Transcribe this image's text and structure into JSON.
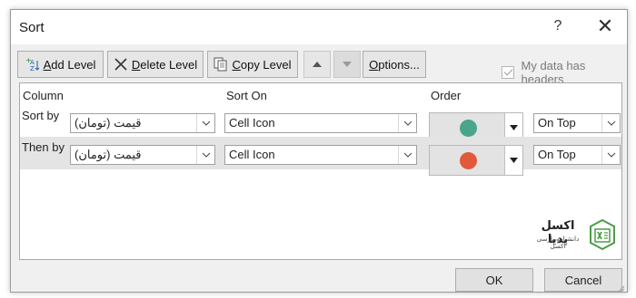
{
  "dialog": {
    "title": "Sort",
    "help_label": "?",
    "close_label": "✕"
  },
  "toolbar": {
    "add_level": {
      "hotkey": "A",
      "rest": "dd Level"
    },
    "delete_level": {
      "hotkey": "D",
      "rest": "elete Level"
    },
    "copy_level": {
      "hotkey": "C",
      "rest": "opy Level"
    },
    "options": {
      "hotkey": "O",
      "rest": "ptions..."
    }
  },
  "headers_check": {
    "label_pre": "My data has ",
    "hotkey": "h",
    "label_post": "eaders",
    "checked": true
  },
  "grid": {
    "headers": {
      "column": "Column",
      "sort_on": "Sort On",
      "order": "Order"
    },
    "rows": [
      {
        "label": "Sort by",
        "column_value": "قیمت (تومان)",
        "sort_on_value": "Cell Icon",
        "icon_color": "#4aa58a",
        "order_value": "On Top",
        "selected": false
      },
      {
        "label": "Then by",
        "column_value": "قیمت (تومان)",
        "sort_on_value": "Cell Icon",
        "icon_color": "#e2593c",
        "order_value": "On Top",
        "selected": true
      }
    ]
  },
  "logo": {
    "title": "اکسل پدیا",
    "subtitle": "دانشنامه پارسی اکسل",
    "color": "#4d9c48"
  },
  "footer": {
    "ok": "OK",
    "cancel": "Cancel"
  }
}
